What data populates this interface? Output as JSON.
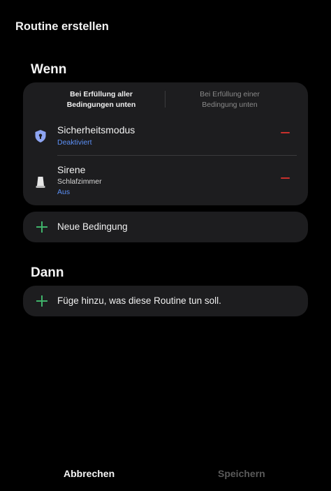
{
  "header": {
    "title": "Routine erstellen"
  },
  "when": {
    "title": "Wenn",
    "match_mode": {
      "all_label_line1": "Bei Erfüllung aller",
      "all_label_line2": "Bedingungen unten",
      "any_label_line1": "Bei Erfüllung einer",
      "any_label_line2": "Bedingung unten",
      "selected": "all"
    },
    "conditions": [
      {
        "name": "Sicherheitsmodus",
        "status": "Deaktiviert",
        "icon": "shield-lock-icon"
      },
      {
        "name": "Sirene",
        "room": "Schlafzimmer",
        "status": "Aus",
        "icon": "siren-icon"
      }
    ],
    "add_condition_label": "Neue Bedingung"
  },
  "then": {
    "title": "Dann",
    "add_action_label": "Füge hinzu, was diese Routine tun soll."
  },
  "footer": {
    "cancel_label": "Abbrechen",
    "save_label": "Speichern"
  },
  "colors": {
    "background": "#000000",
    "card": "#1d1d1f",
    "accent_blue": "#5b8ff5",
    "remove_red": "#c9302c",
    "add_green": "#3fb36a",
    "disabled_text": "#5a5a5a"
  }
}
